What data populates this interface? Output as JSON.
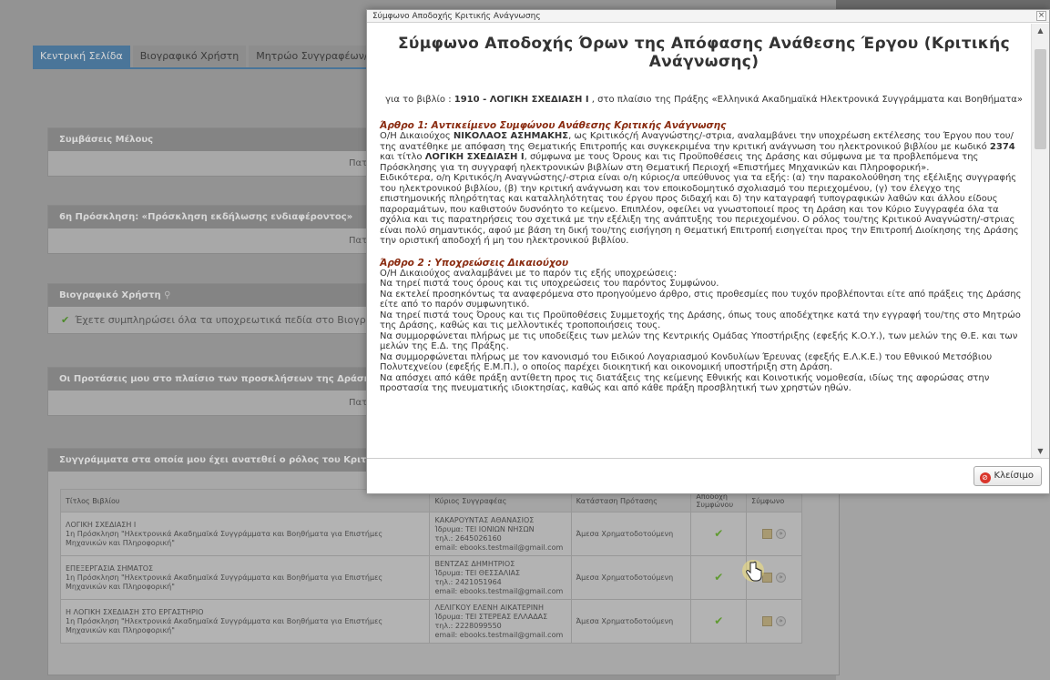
{
  "tabs": [
    "Κεντρική Σελίδα",
    "Βιογραφικό Χρήστη",
    "Μητρώο Συγγραφέων/"
  ],
  "panels": {
    "member_contracts": {
      "title": "Συμβάσεις Μέλους",
      "body": "Πατήστε"
    },
    "invitation": {
      "title": "6η Πρόσκληση: «Πρόσκληση εκδήλωσης ενδιαφέροντος»",
      "body": "Πατήστε"
    },
    "cv": {
      "title": "Βιογραφικό Χρήστη",
      "body": "Έχετε συμπληρώσει όλα τα υποχρεωτικά πεδία στο Βιογρ"
    },
    "proposals": {
      "title": "Οι Προτάσεις μου στο πλαίσιο των προσκλήσεων της Δράσης",
      "body": "Πατήστε"
    },
    "books": {
      "title": "Συγγράμματα στα οποία μου έχει ανατεθεί ο ρόλος του Κριτι"
    }
  },
  "table": {
    "headers": [
      "Τίτλος Βιβλίου",
      "Κύριος Συγγραφέας",
      "Κατάσταση Πρότασης",
      "Αποδοχή Συμφώνου",
      "Σύμφωνο"
    ],
    "rows": [
      {
        "title": "ΛΟΓΙΚΗ ΣΧΕΔΙΑΣΗ Ι",
        "desc": "1η Πρόσκληση \"Ηλεκτρονικά Ακαδημαϊκά Συγγράμματα και Βοηθήματα για Επιστήμες Μηχανικών και Πληροφορική\"",
        "author": "ΚΑΚΑΡΟΥΝΤΑΣ ΑΘΑΝΑΣΙΟΣ",
        "institution": "Ίδρυμα: ΤΕΙ ΙΟΝΙΩΝ ΝΗΣΩΝ",
        "phone": "τηλ.: 2645026160",
        "email": "email: ebooks.testmail@gmail.com",
        "status": "Άμεσα Χρηματοδοτούμενη"
      },
      {
        "title": "ΕΠΕΞΕΡΓΑΣΙΑ ΣΗΜΑΤΟΣ",
        "desc": "1η Πρόσκληση \"Ηλεκτρονικά Ακαδημαϊκά Συγγράμματα και Βοηθήματα για Επιστήμες Μηχανικών και Πληροφορική\"",
        "author": "ΒΕΝΤΖΑΣ ΔΗΜΗΤΡΙΟΣ",
        "institution": "Ίδρυμα: ΤΕΙ ΘΕΣΣΑΛΙΑΣ",
        "phone": "τηλ.: 2421051964",
        "email": "email: ebooks.testmail@gmail.com",
        "status": "Άμεσα Χρηματοδοτούμενη"
      },
      {
        "title": "Η ΛΟΓΙΚΗ ΣΧΕΔΙΑΣΗ ΣΤΟ ΕΡΓΑΣΤΗΡΙΟ",
        "desc": "1η Πρόσκληση \"Ηλεκτρονικά Ακαδημαϊκά Συγγράμματα και Βοηθήματα για Επιστήμες Μηχανικών και Πληροφορική\"",
        "author": "ΛΕΛΙΓΚΟΥ ΕΛΕΝΗ ΑΙΚΑΤΕΡΙΝΗ",
        "institution": "Ίδρυμα: ΤΕΙ ΣΤΕΡΕΑΣ ΕΛΛΑΔΑΣ",
        "phone": "τηλ.: 2228099550",
        "email": "email: ebooks.testmail@gmail.com",
        "status": "Άμεσα Χρηματοδοτούμενη"
      }
    ]
  },
  "dialog": {
    "window_title": "Σύμφωνο Αποδοχής Κριτικής Ανάγνωσης",
    "close_x": "×",
    "heading": "Σύμφωνο Αποδοχής Όρων της Απόφασης Ανάθεσης Έργου (Κριτικής Ανάγνωσης)",
    "intro_pre": "για το βιβλίο : ",
    "intro_book": "1910 - ΛΟΓΙΚΗ ΣΧΕΔΙΑΣΗ Ι",
    "intro_post": " , στο πλαίσιο της Πράξης «Ελληνικά Ακαδημαϊκά Ηλεκτρονικά Συγγράμματα και Βοηθήματα»",
    "article1_title": "Άρθρο 1: Αντικείμενο Συμφώνου Ανάθεσης Κριτικής Ανάγνωσης",
    "article1_p1_a": "Ο/Η Δικαιούχος ",
    "article1_name": "ΝΙΚΟΛΑΟΣ ΑΣΗΜΑΚΗΣ",
    "article1_p1_b": ", ως Κριτικός/ή Αναγνώστης/-στρια, αναλαμβάνει την υποχρέωση εκτέλεσης του Έργου που του/της ανατέθηκε με απόφαση της Θεματικής Επιτροπής και συγκεκριμένα την κριτική ανάγνωση του ηλεκτρονικού βιβλίου με κωδικό ",
    "article1_code": "2374",
    "article1_p1_c": " και τίτλο ",
    "article1_booktitle": "ΛΟΓΙΚΗ ΣΧΕΔΙΑΣΗ Ι",
    "article1_p1_d": ", σύμφωνα με τους Όρους και τις Προϋποθέσεις της Δράσης και σύμφωνα με τα προβλεπόμενα της Πρόσκλησης για τη συγγραφή ηλεκτρονικών βιβλίων στη Θεματική Περιοχή «Επιστήμες Μηχανικών και Πληροφορική».",
    "article1_p2": "Ειδικότερα, ο/η Κριτικός/η Αναγνώστης/-στρια είναι ο/η κύριος/α υπεύθυνος για τα εξής: (α) την παρακολούθηση της εξέλιξης συγγραφής του ηλεκτρονικού βιβλίου, (β) την κριτική ανάγνωση και τον εποικοδομητικό σχολιασμό του περιεχομένου, (γ) τον έλεγχο της επιστημονικής πληρότητας και καταλληλότητας του έργου προς διδαχή και δ) την καταγραφή τυπογραφικών λαθών και άλλου είδους παροραμάτων, που καθιστούν δυσνόητο το κείμενο. Επιπλέον, οφείλει να γνωστοποιεί προς τη Δράση και τον Κύριο Συγγραφέα όλα τα σχόλια και τις παρατηρήσεις του σχετικά με την εξέλιξη της ανάπτυξης του περιεχομένου. Ο ρόλος του/της Κριτικού Αναγνώστη/-στριας είναι πολύ σημαντικός, αφού με βάση τη δική του/της εισήγηση η Θεματική Επιτροπή εισηγείται προς την Επιτροπή Διοίκησης της Δράσης την οριστική αποδοχή ή μη του ηλεκτρονικού βιβλίου.",
    "article2_title": "Άρθρο 2 : Υποχρεώσεις Δικαιούχου",
    "article2_lines": [
      "Ο/Η Δικαιούχος αναλαμβάνει με το παρόν τις εξής υποχρεώσεις:",
      "Να τηρεί πιστά τους όρους και τις υποχρεώσεις του παρόντος Συμφώνου.",
      "Να εκτελεί προσηκόντως τα αναφερόμενα στο προηγούμενο άρθρο, στις προθεσμίες που τυχόν προβλέπονται είτε από πράξεις της Δράσης είτε από το παρόν συμφωνητικό.",
      "Να τηρεί πιστά τους Όρους και τις Προϋποθέσεις Συμμετοχής της Δράσης, όπως τους αποδέχτηκε κατά την εγγραφή του/της στο Μητρώο της Δράσης, καθώς και τις μελλοντικές τροποποιήσεις τους.",
      "Να συμμορφώνεται πλήρως με τις υποδείξεις των μελών της Κεντρικής Ομάδας Υποστήριξης (εφεξής Κ.Ο.Υ.), των μελών της Θ.Ε. και των μελών της Ε.Δ. της Πράξης.",
      "Να συμμορφώνεται πλήρως με τον κανονισμό του Ειδικού Λογαριασμού Κονδυλίων Έρευνας (εφεξής Ε.Λ.Κ.Ε.) του Εθνικού Μετσόβιου Πολυτεχνείου (εφεξής Ε.Μ.Π.), ο οποίος παρέχει διοικητική και οικονομική υποστήριξη στη Δράση.",
      "Να απόσχει από κάθε πράξη αντίθετη προς τις διατάξεις της κείμενης Εθνικής και Κοινοτικής νομοθεσία, ιδίως της αφορώσας στην προστασία της πνευματικής ιδιοκτησίας, καθώς και από κάθε πράξη προσβλητική των χρηστών ηθών."
    ],
    "close_button": "Κλείσιμο"
  }
}
